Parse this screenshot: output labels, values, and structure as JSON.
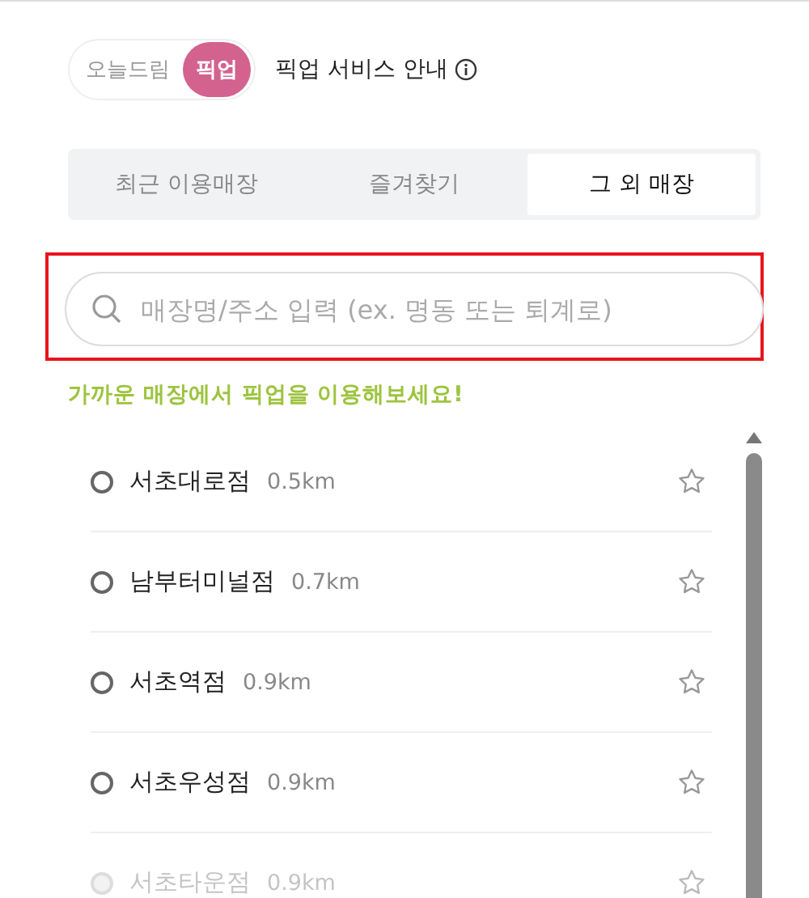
{
  "mode_toggle": {
    "options": [
      {
        "label": "오늘드림",
        "selected": false
      },
      {
        "label": "픽업",
        "selected": true
      }
    ]
  },
  "service_info": {
    "label": "픽업 서비스 안내"
  },
  "tabs": [
    {
      "label": "최근 이용매장",
      "selected": false
    },
    {
      "label": "즐겨찾기",
      "selected": false
    },
    {
      "label": "그 외 매장",
      "selected": true
    }
  ],
  "search": {
    "placeholder": "매장명/주소 입력 (ex. 명동 또는 퇴계로)",
    "highlighted": true
  },
  "hint": "가까운 매장에서 픽업을 이용해보세요!",
  "stores": [
    {
      "name": "서초대로점",
      "distance": "0.5km",
      "selected": false,
      "favorite": false,
      "disabled": false
    },
    {
      "name": "남부터미널점",
      "distance": "0.7km",
      "selected": false,
      "favorite": false,
      "disabled": false
    },
    {
      "name": "서초역점",
      "distance": "0.9km",
      "selected": false,
      "favorite": false,
      "disabled": false
    },
    {
      "name": "서초우성점",
      "distance": "0.9km",
      "selected": false,
      "favorite": false,
      "disabled": false
    },
    {
      "name": "서초타운점",
      "distance": "0.9km",
      "selected": false,
      "favorite": false,
      "disabled": true
    }
  ]
}
